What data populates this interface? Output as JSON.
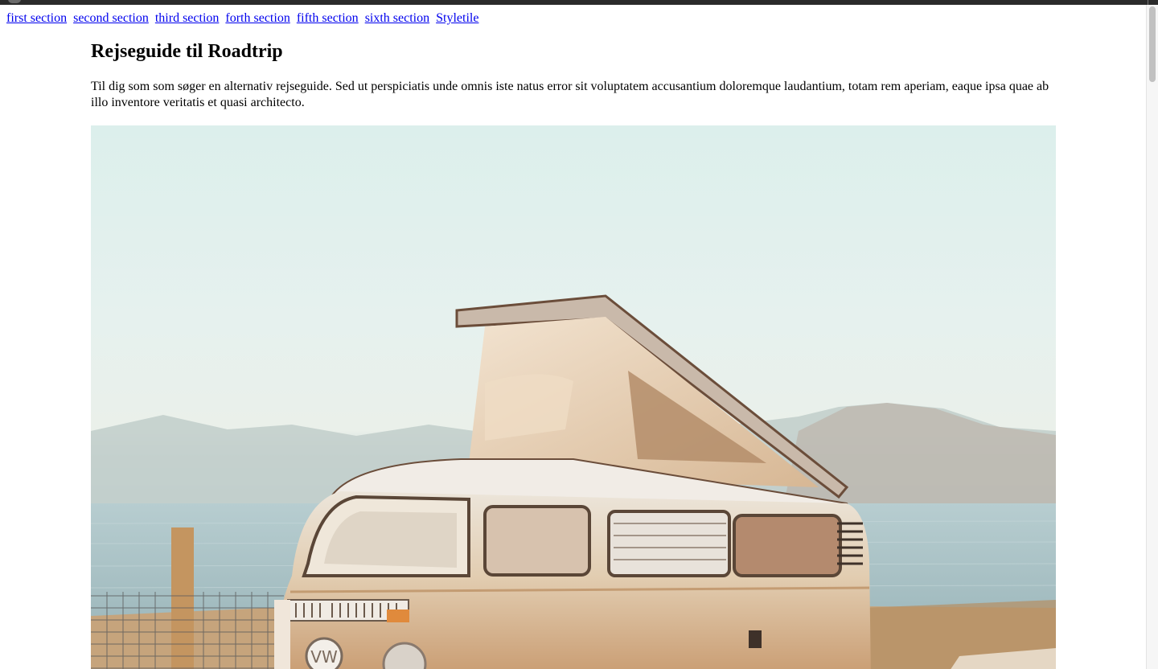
{
  "nav": {
    "links": [
      "first section",
      "second section",
      "third section",
      "forth section",
      "fifth section",
      "sixth section",
      "Styletile"
    ]
  },
  "article": {
    "title": "Rejseguide til Roadtrip",
    "intro": "Til dig som som søger en alternativ rejseguide. Sed ut perspiciatis unde omnis iste natus error sit voluptatem accusantium doloremque laudantium, totam rem aperiam, eaque ipsa quae ab illo inventore veritatis et quasi architecto."
  },
  "colors": {
    "link": "#0000ee",
    "topbar": "#2b2b2b",
    "sky": "#dcefec",
    "van_body": "#e9d3b6"
  },
  "icons": {
    "van": "camper-van-photo"
  }
}
